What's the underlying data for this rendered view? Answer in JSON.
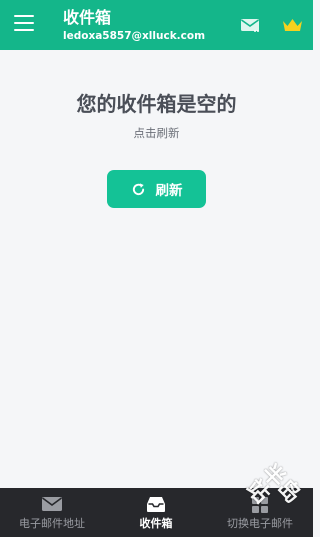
{
  "header": {
    "title": "收件箱",
    "email": "ledoxa5857@xlluck.com",
    "icons": [
      "menu-icon",
      "mail-check-icon",
      "crown-icon"
    ]
  },
  "empty_state": {
    "title": "您的收件箱是空的",
    "subtitle": "点击刷新",
    "refresh_label": "刷新",
    "refresh_icon": "refresh-icon"
  },
  "bottom_nav": {
    "items": [
      {
        "label": "电子邮件地址",
        "icon": "mail-icon",
        "active": false
      },
      {
        "label": "收件箱",
        "icon": "inbox-icon",
        "active": true
      },
      {
        "label": "切换电子邮件",
        "icon": "grid-icon",
        "active": false
      }
    ]
  },
  "watermark": "半岛站",
  "colors": {
    "accent": "#14b68a",
    "button": "#14c296",
    "crown": "#f5d21e",
    "nav_background": "#27282c"
  }
}
